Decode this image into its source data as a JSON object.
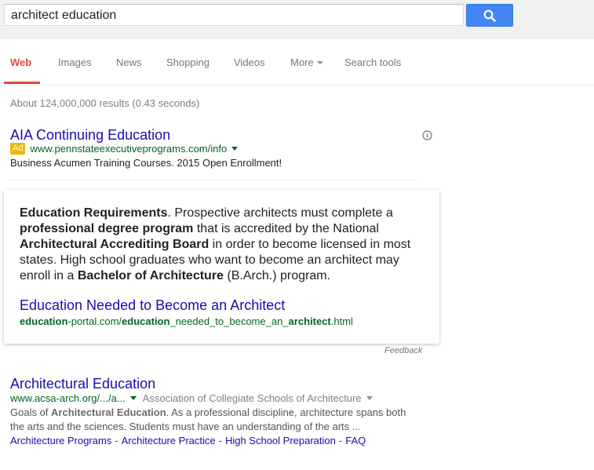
{
  "search": {
    "query": "architect education",
    "button_icon": "search-icon"
  },
  "tabs": [
    {
      "label": "Web",
      "active": true
    },
    {
      "label": "Images"
    },
    {
      "label": "News"
    },
    {
      "label": "Shopping"
    },
    {
      "label": "Videos"
    },
    {
      "label": "More"
    },
    {
      "label": "Search tools"
    }
  ],
  "stats": "About 124,000,000 results (0.43 seconds)",
  "ad": {
    "title": "AIA Continuing Education",
    "badge": "Ad",
    "url": "www.pennstateexecutiveprograms.com/info",
    "description": "Business Acumen Training Courses. 2015 Open Enrollment!"
  },
  "answer": {
    "p1_b": "Education Requirements",
    "p1": ". Prospective architects must complete a ",
    "p2_b": "professional degree program",
    "p2": " that is accredited by the National ",
    "p3_b": "Architectural Accrediting Board",
    "p3": " in order to become licensed in most states. High school graduates who want to become an architect may enroll in a ",
    "p4_b": "Bachelor of Architecture",
    "p4": " (B.Arch.) program.",
    "link_title": "Education Needed to Become an Architect",
    "url_b1": "education",
    "url_1": "-portal.com/",
    "url_b2": "education",
    "url_2": "_needed_to_become_an_",
    "url_b3": "architect",
    "url_3": ".html",
    "feedback": "Feedback"
  },
  "result2": {
    "title": "Architectural Education",
    "url": "www.acsa-arch.org/.../a...",
    "source": "Association of Collegiate Schools of Architecture",
    "s1": "Goals of ",
    "s1_b": "Architectural Education",
    "s2": ". As a professional discipline, architecture spans both the arts and the sciences. Students must have an understanding of the arts ...",
    "sitelinks": [
      "Architecture Programs",
      "Architecture Practice",
      "High School Preparation",
      "FAQ"
    ]
  },
  "colors": {
    "accent": "#dd4b39",
    "link": "#1a0dab",
    "url": "#006621",
    "search_button": "#4285f4",
    "ad_badge": "#edb802"
  }
}
